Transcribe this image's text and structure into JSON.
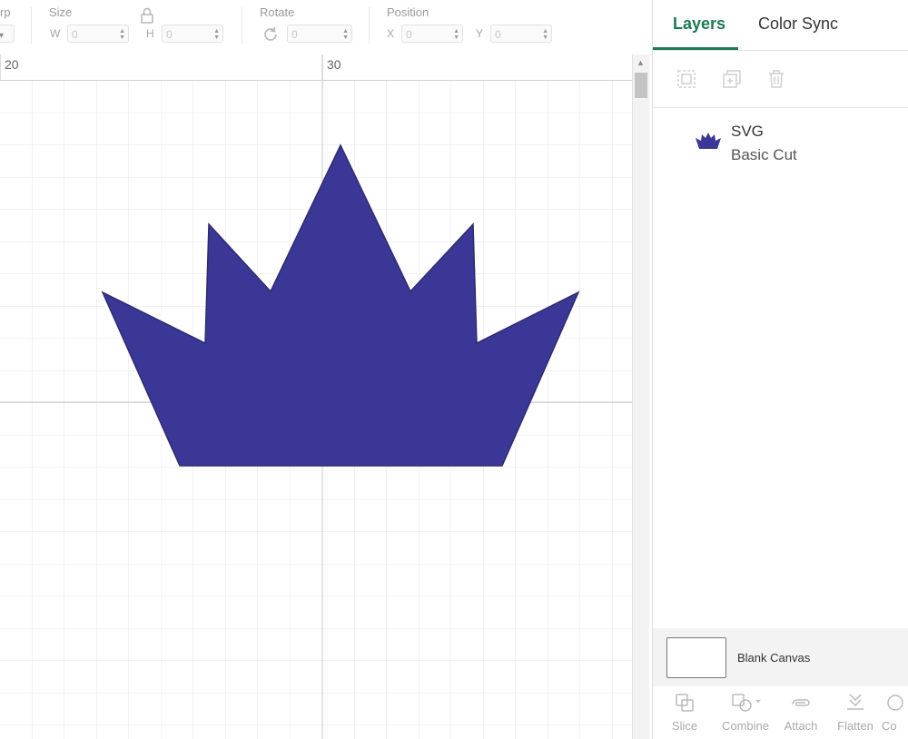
{
  "toolbar": {
    "warp_label_partial": "rp",
    "size_label": "Size",
    "w_letter": "W",
    "h_letter": "H",
    "w_value": "0",
    "h_value": "0",
    "rotate_label": "Rotate",
    "rotate_value": "0",
    "position_label": "Position",
    "x_letter": "X",
    "y_letter": "Y",
    "x_value": "0",
    "y_value": "0"
  },
  "ruler": {
    "ticks": [
      "20",
      "30"
    ]
  },
  "canvas": {
    "shape_color": "#3a3797",
    "grid_color": "#dcdcdc",
    "shape_icon": "crown-shape"
  },
  "panel": {
    "tabs": [
      {
        "label": "Layers",
        "active": true
      },
      {
        "label": "Color Sync",
        "active": false
      }
    ],
    "actions": [
      {
        "icon": "group-icon",
        "enabled": false
      },
      {
        "icon": "duplicate-icon",
        "enabled": false
      },
      {
        "icon": "delete-icon",
        "enabled": false
      }
    ],
    "layers": [
      {
        "name": "SVG",
        "operation": "Basic Cut",
        "thumb_icon": "crown-icon",
        "color": "#3a3797"
      }
    ],
    "canvas_label": "Blank Canvas",
    "bottom_actions": [
      {
        "label": "Slice",
        "icon": "slice-icon"
      },
      {
        "label": "Combine",
        "icon": "combine-icon"
      },
      {
        "label": "Attach",
        "icon": "attach-icon"
      },
      {
        "label": "Flatten",
        "icon": "flatten-icon"
      },
      {
        "label": "Co",
        "icon": "contour-icon"
      }
    ]
  },
  "accent_color": "#1a7a52"
}
